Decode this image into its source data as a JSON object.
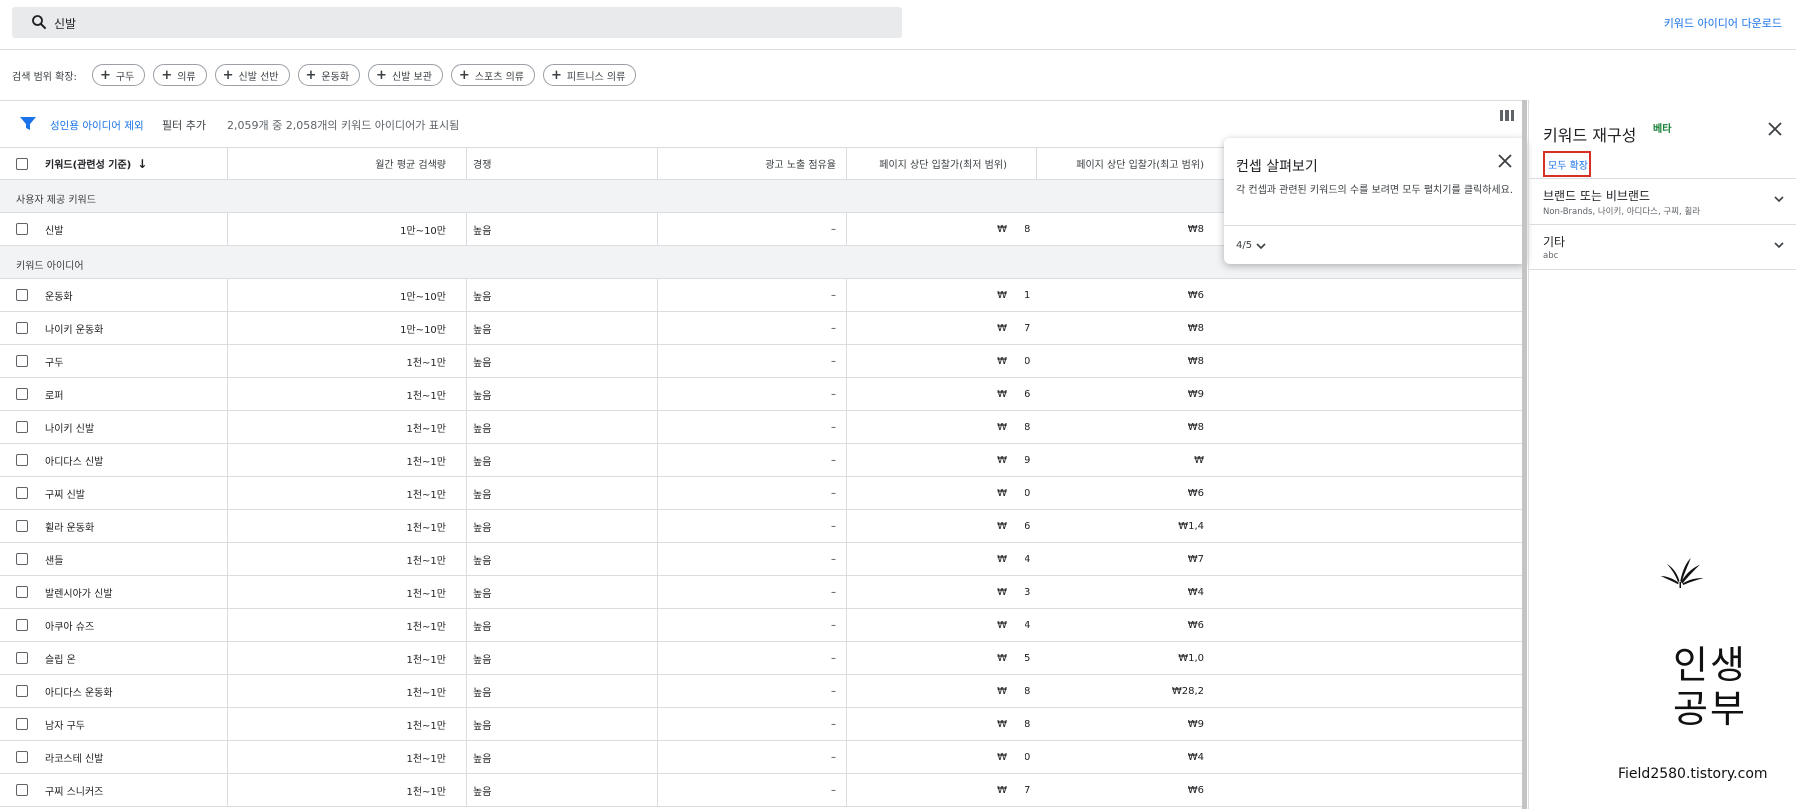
{
  "search": {
    "query": "신발"
  },
  "header": {
    "download_label": "키워드 아이디어 다운로드"
  },
  "scope": {
    "label": "검색 범위 확장:",
    "chips": [
      "구두",
      "의류",
      "신발 선반",
      "운동화",
      "신발 보관",
      "스포츠 의류",
      "피트니스 의류"
    ]
  },
  "filters": {
    "adult_filter": "성인용 아이디어 제외",
    "add_filter": "필터 추가",
    "count_text": "2,059개 중 2,058개의 키워드 아이디어가 표시됨"
  },
  "table": {
    "headers": {
      "keyword": "키워드(관련성 기준)",
      "volume": "월간 평균 검색량",
      "competition": "경쟁",
      "impression_share": "광고 노출 점유율",
      "bid_low": "페이지 상단 입찰가(최저 범위)",
      "bid_high": "페이지 상단 입찰가(최고 범위)"
    },
    "group_user": "사용자 제공 키워드",
    "group_ideas": "키워드 아이디어",
    "user_rows": [
      {
        "keyword": "신발",
        "volume": "1만~10만",
        "competition": "높음",
        "share": "–",
        "low": "₩",
        "low_tail": "8",
        "high": "₩8"
      }
    ],
    "idea_rows": [
      {
        "keyword": "운동화",
        "volume": "1만~10만",
        "competition": "높음",
        "share": "–",
        "low": "₩",
        "low_tail": "1",
        "high": "₩6"
      },
      {
        "keyword": "나이키 운동화",
        "volume": "1만~10만",
        "competition": "높음",
        "share": "–",
        "low": "₩",
        "low_tail": "7",
        "high": "₩8"
      },
      {
        "keyword": "구두",
        "volume": "1천~1만",
        "competition": "높음",
        "share": "–",
        "low": "₩",
        "low_tail": "0",
        "high": "₩8"
      },
      {
        "keyword": "로퍼",
        "volume": "1천~1만",
        "competition": "높음",
        "share": "–",
        "low": "₩",
        "low_tail": "6",
        "high": "₩9"
      },
      {
        "keyword": "나이키 신발",
        "volume": "1천~1만",
        "competition": "높음",
        "share": "–",
        "low": "₩",
        "low_tail": "8",
        "high": "₩8"
      },
      {
        "keyword": "아디다스 신발",
        "volume": "1천~1만",
        "competition": "높음",
        "share": "–",
        "low": "₩",
        "low_tail": "9",
        "high": "₩"
      },
      {
        "keyword": "구찌 신발",
        "volume": "1천~1만",
        "competition": "높음",
        "share": "–",
        "low": "₩",
        "low_tail": "0",
        "high": "₩6"
      },
      {
        "keyword": "휠라 운동화",
        "volume": "1천~1만",
        "competition": "높음",
        "share": "–",
        "low": "₩",
        "low_tail": "6",
        "high": "₩1,4"
      },
      {
        "keyword": "샌들",
        "volume": "1천~1만",
        "competition": "높음",
        "share": "–",
        "low": "₩",
        "low_tail": "4",
        "high": "₩7"
      },
      {
        "keyword": "발렌시아가 신발",
        "volume": "1천~1만",
        "competition": "높음",
        "share": "–",
        "low": "₩",
        "low_tail": "3",
        "high": "₩4"
      },
      {
        "keyword": "아쿠아 슈즈",
        "volume": "1천~1만",
        "competition": "높음",
        "share": "–",
        "low": "₩",
        "low_tail": "4",
        "high": "₩6"
      },
      {
        "keyword": "슬립 온",
        "volume": "1천~1만",
        "competition": "높음",
        "share": "–",
        "low": "₩",
        "low_tail": "5",
        "high": "₩1,0"
      },
      {
        "keyword": "아디다스 운동화",
        "volume": "1천~1만",
        "competition": "높음",
        "share": "–",
        "low": "₩",
        "low_tail": "8",
        "high": "₩28,2"
      },
      {
        "keyword": "남자 구두",
        "volume": "1천~1만",
        "competition": "높음",
        "share": "–",
        "low": "₩",
        "low_tail": "8",
        "high": "₩9"
      },
      {
        "keyword": "라코스테 신발",
        "volume": "1천~1만",
        "competition": "높음",
        "share": "–",
        "low": "₩",
        "low_tail": "0",
        "high": "₩4"
      },
      {
        "keyword": "구찌 스니커즈",
        "volume": "1천~1만",
        "competition": "높음",
        "share": "–",
        "low": "₩",
        "low_tail": "7",
        "high": "₩6"
      }
    ]
  },
  "popup": {
    "title": "컨셉 살펴보기",
    "body": "각 컨셉과 관련된 키워드의 수를 보려면 모두 펼치기를 클릭하세요.",
    "pager": "4/5"
  },
  "panel": {
    "title": "키워드 재구성",
    "beta": "베타",
    "expand_all": "모두 확장",
    "groups": [
      {
        "title": "브랜드 또는 비브랜드",
        "sub": "Non-Brands, 나이키, 아디다스, 구찌, 휠라"
      },
      {
        "title": "기타",
        "sub": "abc"
      }
    ]
  },
  "watermark": {
    "line1": "인생",
    "line2": "공부",
    "url": "Field2580.tistory.com"
  },
  "colors": {
    "accent": "#1a73e8",
    "beta_green": "#188038",
    "highlight_red": "#d93025"
  }
}
